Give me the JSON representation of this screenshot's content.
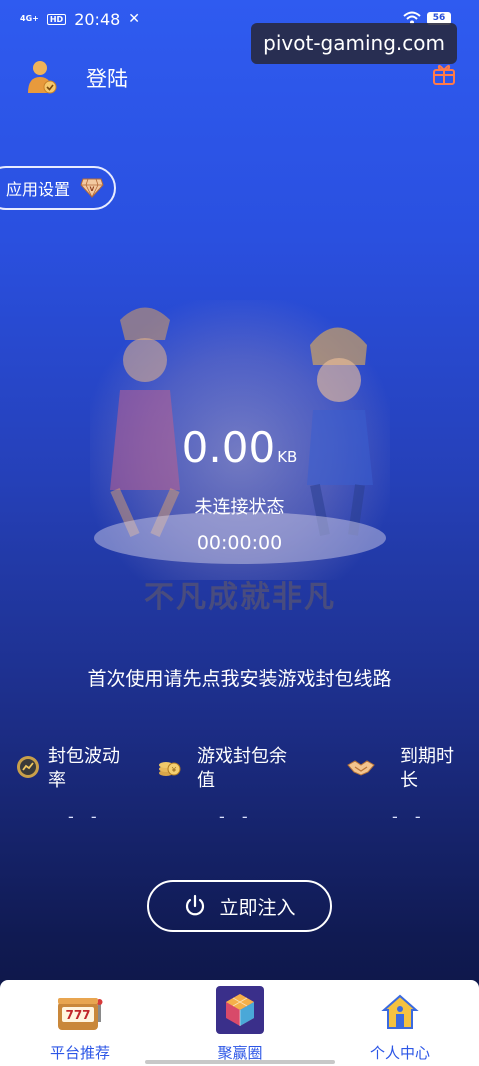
{
  "status_bar": {
    "signal_label": "4G+",
    "hd_label": "HD",
    "time": "20:48",
    "battery": "56"
  },
  "watermark": "pivot-gaming.com",
  "header": {
    "login_label": "登陆"
  },
  "app_settings_label": "应用设置",
  "hero": {
    "slogan": "不凡成就非凡"
  },
  "traffic": {
    "value": "0.00",
    "unit": "KB",
    "status": "未连接状态",
    "timer": "00:00:00"
  },
  "install_tip": "首次使用请先点我安装游戏封包线路",
  "stats": [
    {
      "label_line1": "封包波动",
      "label_line2": "率",
      "value": "- -",
      "icon": "coin-chart-icon"
    },
    {
      "label_line1": "游戏封包余",
      "label_line2": "值",
      "value": "- -",
      "icon": "coin-stack-icon"
    },
    {
      "label_line1": "到期时",
      "label_line2": "长",
      "value": "- -",
      "icon": "handshake-icon"
    }
  ],
  "inject_button": "立即注入",
  "bottom_nav": [
    {
      "label": "平台推荐",
      "icon": "slot-machine-icon"
    },
    {
      "label": "聚赢圈",
      "icon": "cube-app-icon"
    },
    {
      "label": "个人中心",
      "icon": "house-user-icon"
    }
  ],
  "colors": {
    "accent_blue": "#2c56e6",
    "bg_top": "#2f5bf0",
    "bg_bottom": "#0c1440"
  }
}
